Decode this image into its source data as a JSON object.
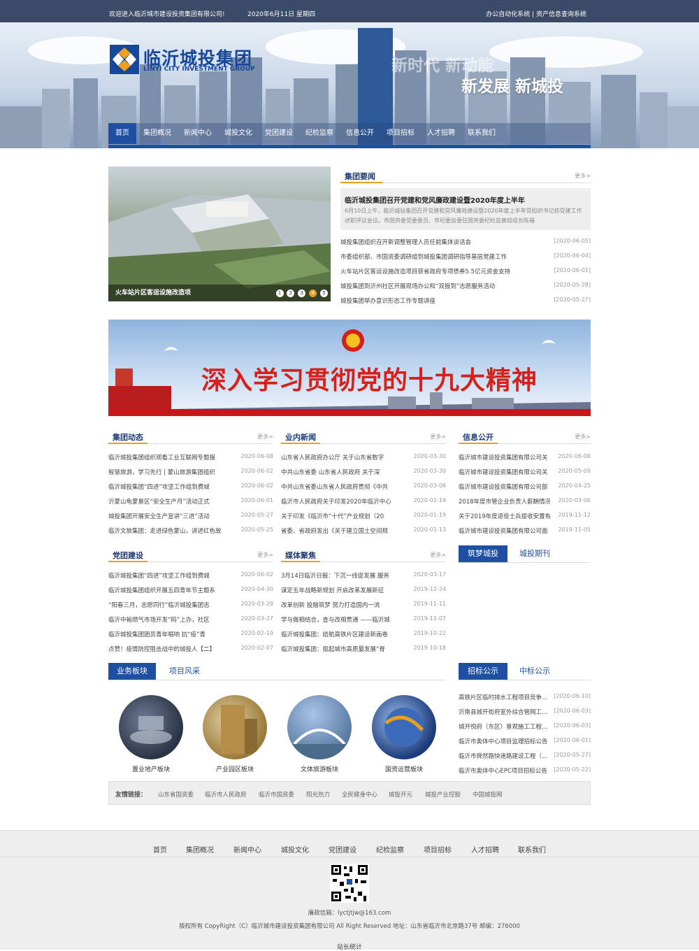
{
  "topbar": {
    "welcome": "欢迎进入临沂城市建设投资集团有限公司!",
    "date": "2020年6月11日 星期四",
    "links": "办公自动化系统 | 资产信息查询系统"
  },
  "logo": {
    "cn": "临沂城投集团",
    "en": "LINYI CITY INVESTMENT GROUP"
  },
  "slogan": {
    "line1": "新时代 新动能",
    "line2": "新发展 新城投"
  },
  "nav": [
    "首页",
    "集团概况",
    "新闻中心",
    "城投文化",
    "党团建设",
    "纪检监察",
    "信息公开",
    "项目招标",
    "人才招聘",
    "联系我们"
  ],
  "slider": {
    "caption": "火车站片区客运设施改造项",
    "dots": [
      "1",
      "2",
      "3",
      "4",
      "5"
    ],
    "active": 4
  },
  "news": {
    "title": "集团要闻",
    "more": "更多>",
    "headline": {
      "title": "临沂城投集团召开党建和党风廉政建设暨2020年度上半年",
      "summary": "6月10日上午，临沂城投集团召开党建和党风廉政建设暨2020年度上半年党组织书记抓党建工作述职评议会议。市国资委党委委员、市纪委监委驻国资委纪检监察组组长陈福"
    },
    "items": [
      {
        "t": "城投集团组织召开新调整管理人员任前集体谈话会",
        "d": "[2020-06-05]"
      },
      {
        "t": "市委组织部、市国资委调研组到城投集团调研指导基层党建工作",
        "d": "[2020-06-04]"
      },
      {
        "t": "火车站片区客运设施改造项目获省政府专项债券5.5亿元资金支持",
        "d": "[2020-06-01]"
      },
      {
        "t": "城投集团到沂州社区开展现场办公和“双报到”志愿服务活动",
        "d": "[2020-05-28]"
      },
      {
        "t": "城投集团举办意识形态工作专题讲座",
        "d": "[2020-05-27]"
      }
    ]
  },
  "banner": {
    "text": "深入学习贯彻党的十九大精神"
  },
  "sections": {
    "dongtai": {
      "title": "集团动态",
      "more": "更多>",
      "items": [
        {
          "t": "临沂城投集团组织观看工业互联网专题报",
          "d": "2020-06-08"
        },
        {
          "t": "智慧旅游，学习先行 | 蒙山旅游集团组织",
          "d": "2020-06-02"
        },
        {
          "t": "临沂城投集团“四进”攻坚工作组到费城",
          "d": "2020-06-02"
        },
        {
          "t": "沂蒙山龟蒙景区“安全生产月”活动正式",
          "d": "2020-06-01"
        },
        {
          "t": "城投集团开展安全生产宣讲“三进”活动",
          "d": "2020-05-27"
        },
        {
          "t": "临沂文旅集团：走进绿色蒙山，讲述红色故",
          "d": "2020-05-25"
        }
      ]
    },
    "yenei": {
      "title": "业内新闻",
      "more": "更多>",
      "items": [
        {
          "t": "山东省人民政府办公厅 关于山东省数字",
          "d": "2020-03-30"
        },
        {
          "t": "中共山东省委 山东省人民政府 关于深",
          "d": "2020-03-30"
        },
        {
          "t": "中共山东省委山东省人民政府贯彻《中共",
          "d": "2020-03-06"
        },
        {
          "t": "临沂市人民政府关于印发2020年临沂中心",
          "d": "2020-01-19"
        },
        {
          "t": "关于印发《临沂市“十代”产业规划（20",
          "d": "2020-01-19"
        },
        {
          "t": "省委、省政府发出《关于建立国土空间规",
          "d": "2020-01-13"
        }
      ]
    },
    "xinxi": {
      "title": "信息公开",
      "more": "更多>",
      "items": [
        {
          "t": "临沂城市建设投资集团有限公司关",
          "d": "2020-06-08"
        },
        {
          "t": "临沂城市建设投资集团有限公司关",
          "d": "2020-05-09"
        },
        {
          "t": "临沂城市建设投资集团有限公司部",
          "d": "2020-04-25"
        },
        {
          "t": "2018年度市管企业负责人薪酬情况",
          "d": "2020-03-06"
        },
        {
          "t": "关于2019年度退役士兵接收安置有",
          "d": "2019-11-12"
        },
        {
          "t": "临沂城市建设投资集团有限公司面",
          "d": "2019-11-05"
        }
      ]
    },
    "dangtuan": {
      "title": "党团建设",
      "more": "更多>",
      "items": [
        {
          "t": "临沂城投集团“四进”攻坚工作组到费城",
          "d": "2020-06-02"
        },
        {
          "t": "临沂城投集团组织开展五四青年节主题系",
          "d": "2020-04-30"
        },
        {
          "t": "“阳春三月，志愿同行”临沂城投集团志",
          "d": "2020-03-29"
        },
        {
          "t": "临沂中裕燃气市场开发“码”上办，社区",
          "d": "2020-03-27"
        },
        {
          "t": "临沂城投集团团员青年唱响 抗“疫”青",
          "d": "2020-02-19"
        },
        {
          "t": "点赞！疫情防控阻击战中的城投人【二】",
          "d": "2020-02-07"
        }
      ]
    },
    "meiti": {
      "title": "媒体聚焦",
      "more": "更多>",
      "items": [
        {
          "t": "3月14日临沂日报：下沉一线促发展 服务",
          "d": "2020-03-17"
        },
        {
          "t": "谋定五年战略新规划 开启改革发展新征",
          "d": "2019-12-24"
        },
        {
          "t": "改革创新 投融筑梦 努力打造国内一流",
          "d": "2019-11-11"
        },
        {
          "t": "学与做相结合，查与改相贯通 ——临沂城",
          "d": "2019-11-07"
        },
        {
          "t": "临沂城投集团：给航高铁片区建设新画卷",
          "d": "2019-10-22"
        },
        {
          "t": "临沂城投集团：挺起城市高质量发展“脊",
          "d": "2019-10-18"
        }
      ]
    }
  },
  "zhumeng": {
    "tabs": [
      "筑梦城投",
      "城投期刊"
    ]
  },
  "business": {
    "tabs": [
      "业务板块",
      "项目风采"
    ],
    "items": [
      "置业地产板块",
      "产业园区板块",
      "文体旅游板块",
      "国资运营板块"
    ]
  },
  "zhaobiao": {
    "tabs": [
      "招标公示",
      "中标公示"
    ],
    "items": [
      {
        "t": "高铁片区临时排水工程项目竞争...",
        "d": "[2020-06-10]"
      },
      {
        "t": "沂南县城开街府室外综合管网工...",
        "d": "[2020-06-03]"
      },
      {
        "t": "城开悦府（东区）景观施工工程...",
        "d": "[2020-06-03]"
      },
      {
        "t": "临沂市奥体中心项目监理招标公告",
        "d": "[2020-06-01]"
      },
      {
        "t": "临沂市舜然路快速路建设工程（...",
        "d": "[2020-05-27]"
      },
      {
        "t": "临沂市奥体中心EPC项目招标公告",
        "d": "[2020-05-22]"
      }
    ]
  },
  "links": {
    "label": "友情链接：",
    "items": [
      "山东省国资委",
      "临沂市人民政府",
      "临沂市国资委",
      "阳光热力",
      "全民健身中心",
      "城投开元",
      "城投产业控股",
      "中国城投网"
    ]
  },
  "footer": {
    "nav": [
      "首页",
      "集团概况",
      "新闻中心",
      "城投文化",
      "党团建设",
      "纪检监察",
      "项目招标",
      "人才招聘",
      "联系我们"
    ],
    "mail": "廉政信箱：lyctjtjw@163.com",
    "copyright": "版权所有 CopyRight（C）临沂城市建设投资集团有限公司 All Right Reserved 地址：山东省临沂市北京路37号 邮编：276000",
    "stat": "站长统计"
  },
  "colors": {
    "primary": "#1e4fa3",
    "accent": "#e9a020",
    "topbar": "#3b4a66"
  }
}
